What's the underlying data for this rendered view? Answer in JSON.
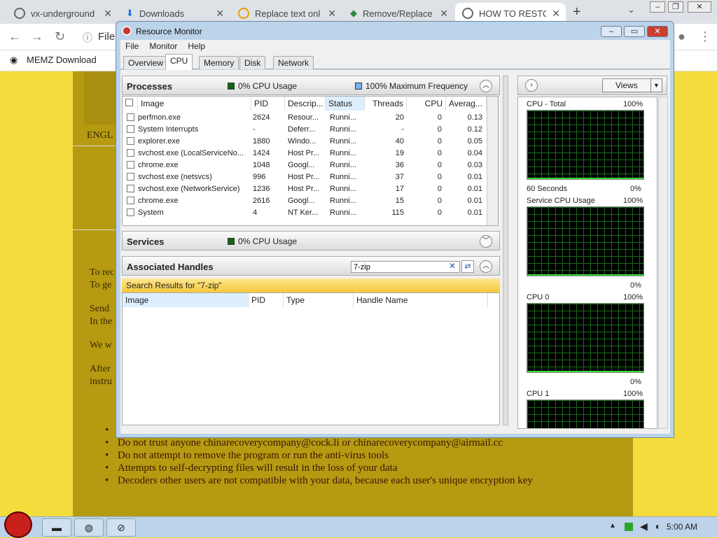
{
  "browser": {
    "tabs": [
      {
        "label": "vx-underground"
      },
      {
        "label": "Downloads"
      },
      {
        "label": "Replace text onl"
      },
      {
        "label": "Remove/Replace"
      },
      {
        "label": "HOW TO RESTO"
      }
    ],
    "address_text": "File",
    "bookmark": "MEMZ Download"
  },
  "page": {
    "lang": "ENGL",
    "lines": [
      "To rec",
      "To ge",
      "Send",
      "In the",
      "We w",
      "After",
      "instru"
    ],
    "bullets": [
      "",
      "Do not trust anyone chinarecoverycompany@cock.li or chinarecoverycompany@airmail.cc",
      "Do not attempt to remove the program or run the anti-virus tools",
      "Attempts to self-decrypting files will result in the loss of your data",
      "Decoders other users are not compatible with your data, because each user's unique encryption key"
    ]
  },
  "rm": {
    "title": "Resource Monitor",
    "menu": [
      "File",
      "Monitor",
      "Help"
    ],
    "tabs": [
      "Overview",
      "CPU",
      "Memory",
      "Disk",
      "Network"
    ],
    "processes": {
      "title": "Processes",
      "cpu_usage": "0% CPU Usage",
      "max_freq": "100% Maximum Frequency",
      "columns": [
        "Image",
        "PID",
        "Descrip...",
        "Status",
        "Threads",
        "CPU",
        "Averag..."
      ],
      "rows": [
        [
          "perfmon.exe",
          "2624",
          "Resour...",
          "Runni...",
          "20",
          "0",
          "0.13"
        ],
        [
          "System Interrupts",
          "-",
          "Deferr...",
          "Runni...",
          "-",
          "0",
          "0.12"
        ],
        [
          "explorer.exe",
          "1880",
          "Windo...",
          "Runni...",
          "40",
          "0",
          "0.05"
        ],
        [
          "svchost.exe (LocalServiceNo...",
          "1424",
          "Host Pr...",
          "Runni...",
          "19",
          "0",
          "0.04"
        ],
        [
          "chrome.exe",
          "1048",
          "Googl...",
          "Runni...",
          "36",
          "0",
          "0.03"
        ],
        [
          "svchost.exe (netsvcs)",
          "996",
          "Host Pr...",
          "Runni...",
          "37",
          "0",
          "0.01"
        ],
        [
          "svchost.exe (NetworkService)",
          "1236",
          "Host Pr...",
          "Runni...",
          "17",
          "0",
          "0.01"
        ],
        [
          "chrome.exe",
          "2616",
          "Googl...",
          "Runni...",
          "15",
          "0",
          "0.01"
        ],
        [
          "System",
          "4",
          "NT Ker...",
          "Runni...",
          "115",
          "0",
          "0.01"
        ]
      ]
    },
    "services": {
      "title": "Services",
      "cpu_usage": "0% CPU Usage"
    },
    "handles": {
      "title": "Associated Handles",
      "search_value": "7-zip",
      "banner": "Search Results for \"7-zip\"",
      "columns": [
        "Image",
        "PID",
        "Type",
        "Handle Name"
      ]
    },
    "graphs": {
      "views_label": "Views",
      "items": [
        {
          "name": "CPU - Total",
          "max": "100%",
          "footer_left": "60 Seconds",
          "footer_right": "0%"
        },
        {
          "name": "Service CPU Usage",
          "max": "100%",
          "footer_left": "",
          "footer_right": "0%"
        },
        {
          "name": "CPU 0",
          "max": "100%",
          "footer_left": "",
          "footer_right": "0%"
        },
        {
          "name": "CPU 1",
          "max": "100%",
          "footer_left": "",
          "footer_right": ""
        }
      ]
    }
  },
  "taskbar": {
    "clock": "5:00 AM"
  }
}
